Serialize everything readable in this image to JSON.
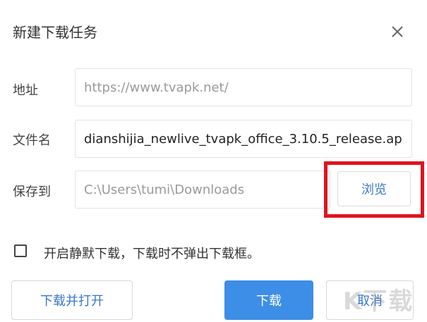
{
  "dialog": {
    "title": "新建下载任务",
    "close_icon": "close-icon"
  },
  "fields": {
    "address": {
      "label": "地址",
      "placeholder": "https://www.tvapk.net/"
    },
    "filename": {
      "label": "文件名",
      "value": "dianshijia_newlive_tvapk_office_3.10.5_release.ap"
    },
    "save_to": {
      "label": "保存到",
      "value": "C:\\Users\\tumi\\Downloads",
      "browse_label": "浏览"
    }
  },
  "silent_download": {
    "label": "开启静默下载，下载时不弹出下载框。",
    "checked": false
  },
  "buttons": {
    "download_and_open": "下载并打开",
    "download": "下载",
    "cancel": "取消"
  },
  "watermark": {
    "text": "K下载"
  },
  "colors": {
    "primary": "#3d8ee6",
    "link_text": "#3a78c8",
    "highlight": "#e0141e"
  }
}
